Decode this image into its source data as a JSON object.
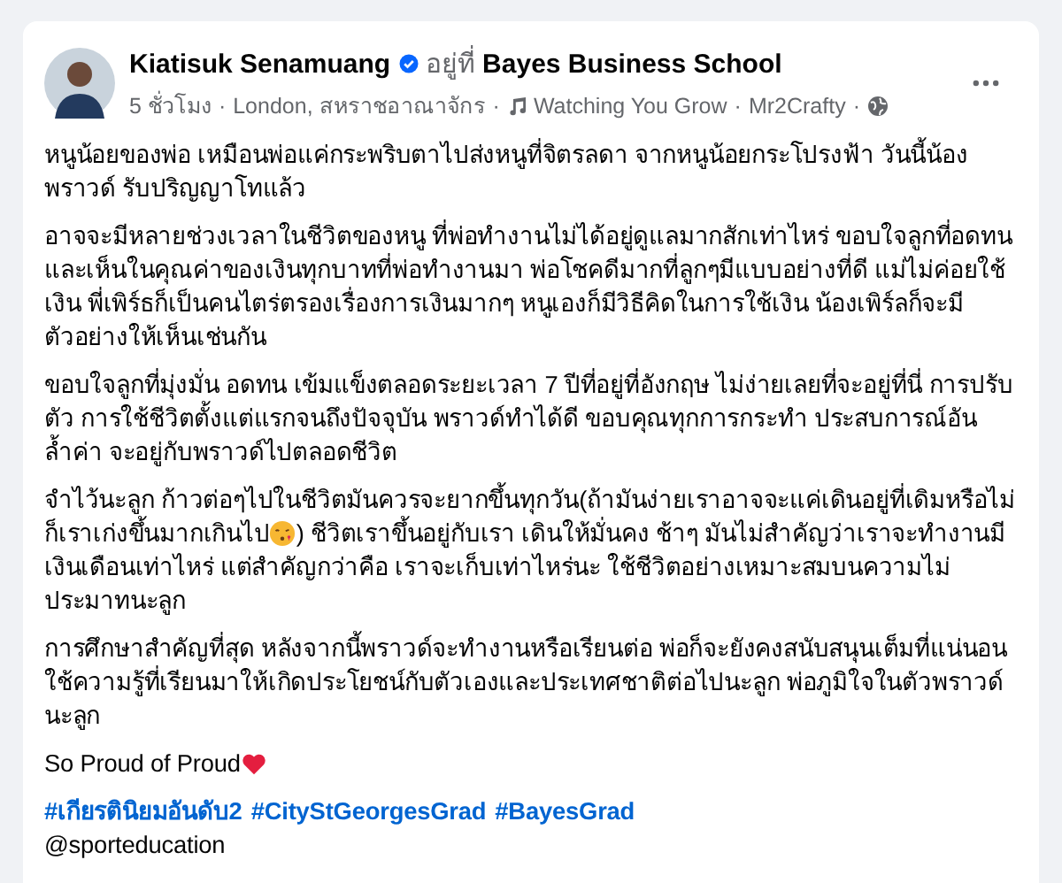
{
  "post": {
    "author": "Kiatisuk Senamuang",
    "verified": true,
    "at_label": "อยู่ที่",
    "place": "Bayes Business School",
    "separator": "·",
    "meta": [
      "5 ชั่วโมง",
      "London, สหราชอาณาจักร"
    ],
    "music": "Watching You Grow",
    "music_artist": "Mr2Crafty",
    "paragraphs": [
      [
        {
          "kind": "text",
          "text": "หนูน้อยของพ่อ เหมือนพ่อแค่กระพริบตาไปส่งหนูที่จิตรลดา จากหนูน้อยกระโปรงฟ้า วันนี้น้องพราวด์ รับปริญญาโทแล้ว"
        }
      ],
      [
        {
          "kind": "text",
          "text": "อาจจะมีหลายช่วงเวลาในชีวิตของหนู ที่พ่อทำงานไม่ได้อยู่ดูแลมากสักเท่าไหร่ ขอบใจลูกที่อดทนและเห็นในคุณค่าของเงินทุกบาทที่พ่อทำงานมา พ่อโชคดีมากที่ลูกๆมีแบบอย่างที่ดี แม่ไม่ค่อยใช้เงิน พี่เพิร์ธก็เป็นคนไตร่ตรองเรื่องการเงินมากๆ หนูเองก็มีวิธีคิดในการใช้เงิน น้องเพิร์ลก็จะมีตัวอย่างให้เห็นเช่นกัน"
        }
      ],
      [
        {
          "kind": "text",
          "text": "ขอบใจลูกที่มุ่งมั่น อดทน เข้มแข็งตลอดระยะเวลา 7 ปีที่อยู่ที่อังกฤษ ไม่ง่ายเลยที่จะอยู่ที่นี่ การปรับตัว การใช้ชีวิตตั้งแต่แรกจนถึงปัจจุบัน พราวด์ทำได้ดี ขอบคุณทุกการกระทำ ประสบการณ์อันล้ำค่า จะอยู่กับพราวด์ไปตลอดชีวิต"
        }
      ],
      [
        {
          "kind": "text",
          "text": "จำไว้นะลูก ก้าวต่อๆไปในชีวิตมันควรจะยากขึ้นทุกวัน(ถ้ามันง่ายเราอาจจะแค่เดินอยู่ที่เดิมหรือไม่ก็เราเก่งขึ้นมากเกินไป"
        },
        {
          "kind": "kiss"
        },
        {
          "kind": "text",
          "text": ") ชีวิตเราขึ้นอยู่กับเรา เดินให้มั่นคง ช้าๆ มันไม่สำคัญว่าเราจะทำงานมีเงินเดือนเท่าไหร่ แต่สำคัญกว่าคือ เราจะเก็บเท่าไหร่นะ ใช้ชีวิตอย่างเหมาะสมบนความไม่ประมาทนะลูก"
        }
      ],
      [
        {
          "kind": "text",
          "text": "การศึกษาสำคัญที่สุด หลังจากนี้พราวด์จะทำงานหรือเรียนต่อ พ่อก็จะยังคงสนับสนุนเต็มที่แน่นอน ใช้ความรู้ที่เรียนมาให้เกิดประโยชน์กับตัวเองและประเทศชาติต่อไปนะลูก พ่อภูมิใจในตัวพราวด์นะลูก"
        }
      ],
      [
        {
          "kind": "text",
          "text": "So Proud of Proud"
        },
        {
          "kind": "heart"
        }
      ]
    ],
    "hashtags": [
      "#เกียรตินิยมอันดับ2",
      "#CityStGeorgesGrad",
      "#BayesGrad"
    ],
    "mention": "@sporteducation"
  }
}
